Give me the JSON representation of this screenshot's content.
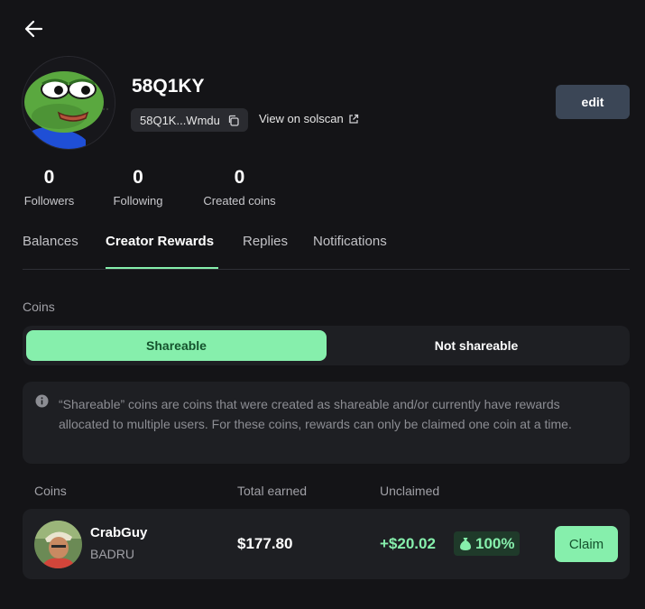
{
  "profile": {
    "username": "58Q1KY",
    "address_short": "58Q1K...Wmdu",
    "solscan_label": "View on solscan",
    "edit_label": "edit"
  },
  "stats": [
    {
      "value": "0",
      "label": "Followers"
    },
    {
      "value": "0",
      "label": "Following"
    },
    {
      "value": "0",
      "label": "Created coins"
    }
  ],
  "tabs": [
    {
      "label": "Balances",
      "active": false
    },
    {
      "label": "Creator Rewards",
      "active": true
    },
    {
      "label": "Replies",
      "active": false
    },
    {
      "label": "Notifications",
      "active": false
    }
  ],
  "section": {
    "coins_label": "Coins",
    "toggle": {
      "selected": "Shareable",
      "options": [
        "Shareable",
        "Not shareable"
      ]
    },
    "info_text": "“Shareable” coins are coins that were created as shareable and/or currently have rewards allocated to multiple users. For these coins, rewards can only be claimed one coin at a time."
  },
  "table": {
    "headers": [
      "Coins",
      "Total earned",
      "Unclaimed"
    ],
    "rows": [
      {
        "name": "CrabGuy",
        "ticker": "BADRU",
        "total_earned": "$177.80",
        "unclaimed": "+$20.02",
        "share": "100%",
        "claim_label": "Claim"
      }
    ]
  },
  "colors": {
    "accent": "#86efac",
    "background": "#141417",
    "panel": "#1e1f23",
    "edit_button": "#3b4656"
  },
  "icons": [
    "back-arrow-icon",
    "copy-icon",
    "external-link-icon",
    "info-icon",
    "money-bag-icon"
  ]
}
